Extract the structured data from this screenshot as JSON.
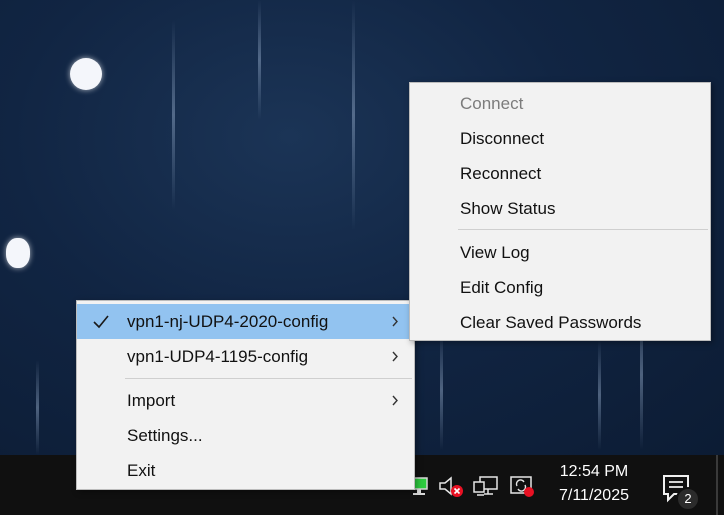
{
  "main_menu": {
    "items": [
      {
        "label": "vpn1-nj-UDP4-2020-config",
        "checked": true,
        "submenu": true,
        "highlighted": true
      },
      {
        "label": "vpn1-UDP4-1195-config",
        "checked": false,
        "submenu": true
      },
      {
        "label": "Import",
        "submenu": true
      },
      {
        "label": "Settings..."
      },
      {
        "label": "Exit"
      }
    ]
  },
  "sub_menu": {
    "items": [
      {
        "label": "Connect",
        "disabled": true
      },
      {
        "label": "Disconnect"
      },
      {
        "label": "Reconnect"
      },
      {
        "label": "Show Status"
      },
      {
        "label": "View Log"
      },
      {
        "label": "Edit Config"
      },
      {
        "label": "Clear Saved Passwords"
      }
    ]
  },
  "taskbar": {
    "clock_time": "12:54 PM",
    "clock_date": "7/11/2025",
    "notification_count": "2",
    "tray_icons": [
      "openvpn-connected-icon",
      "volume-muted-icon",
      "network-icon",
      "sync-status-icon"
    ]
  },
  "colors": {
    "highlight": "#92c3f0",
    "menu_bg": "#f2f2f2",
    "taskbar_bg": "#101010",
    "error_badge": "#e81123",
    "vpn_green": "#2ecc40"
  }
}
